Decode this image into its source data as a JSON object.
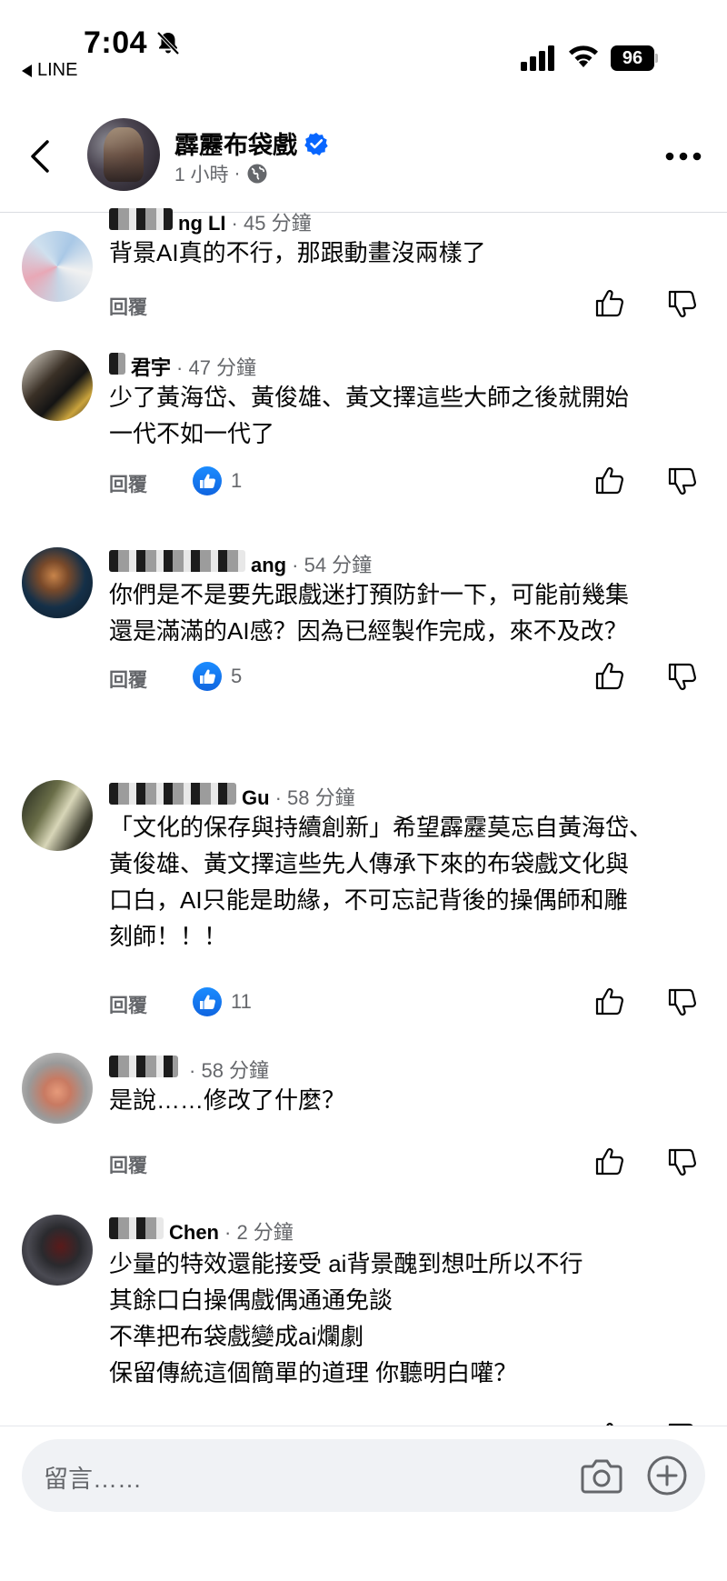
{
  "status_bar": {
    "time": "7:04",
    "back_app": "LINE",
    "battery": "96",
    "icons": [
      "bell-slash-icon",
      "signal-icon",
      "wifi-icon",
      "battery-icon"
    ]
  },
  "post_header": {
    "page_name": "霹靂布袋戲",
    "post_time": "1 小時",
    "separator": "·",
    "icons": [
      "chevron-left-icon",
      "verified-icon",
      "globe-icon",
      "more-icon"
    ]
  },
  "comments": [
    {
      "name_visible": "ng LI",
      "time": "45 分鐘",
      "lines": [
        "背景AI真的不行，那跟動畫沒兩樣了"
      ],
      "reply": "回覆",
      "likes": ""
    },
    {
      "name_visible": "君宇",
      "time": "47 分鐘",
      "lines": [
        "少了黃海岱、黃俊雄、黃文擇這些大師之後就開始",
        "一代不如一代了"
      ],
      "reply": "回覆",
      "likes": "1"
    },
    {
      "name_visible": "ang",
      "time": "54 分鐘",
      "lines": [
        "你們是不是要先跟戲迷打預防針一下，可能前幾集",
        "還是滿滿的AI感？因為已經製作完成，來不及改？"
      ],
      "reply": "回覆",
      "likes": "5"
    },
    {
      "name_visible": "Gu",
      "time": "58 分鐘",
      "lines": [
        "「文化的保存與持續創新」希望霹靂莫忘自黃海岱、",
        "黃俊雄、黃文擇這些先人傳承下來的布袋戲文化與",
        "口白，AI只能是助緣，不可忘記背後的操偶師和雕",
        "刻師！！！"
      ],
      "reply": "回覆",
      "likes": "11"
    },
    {
      "name_visible": "",
      "time": "58 分鐘",
      "lines": [
        "是說……修改了什麼？"
      ],
      "reply": "回覆",
      "likes": ""
    },
    {
      "name_visible": "Chen",
      "time": "2 分鐘",
      "lines": [
        "少量的特效還能接受 ai背景醜到想吐所以不行",
        "其餘口白操偶戲偶通通免談",
        "不準把布袋戲變成ai爛劇",
        "保留傳統這個簡單的道理 你聽明白嚾？"
      ],
      "reply": "回覆",
      "likes": ""
    }
  ],
  "composer": {
    "placeholder": "留言……",
    "icons": [
      "camera-icon",
      "plus-circle-icon"
    ]
  },
  "colors": {
    "like_blue": "#1877f2",
    "verified_blue": "#0866ff",
    "secondary_text": "#65676b",
    "composer_bg": "#f0f2f5"
  }
}
